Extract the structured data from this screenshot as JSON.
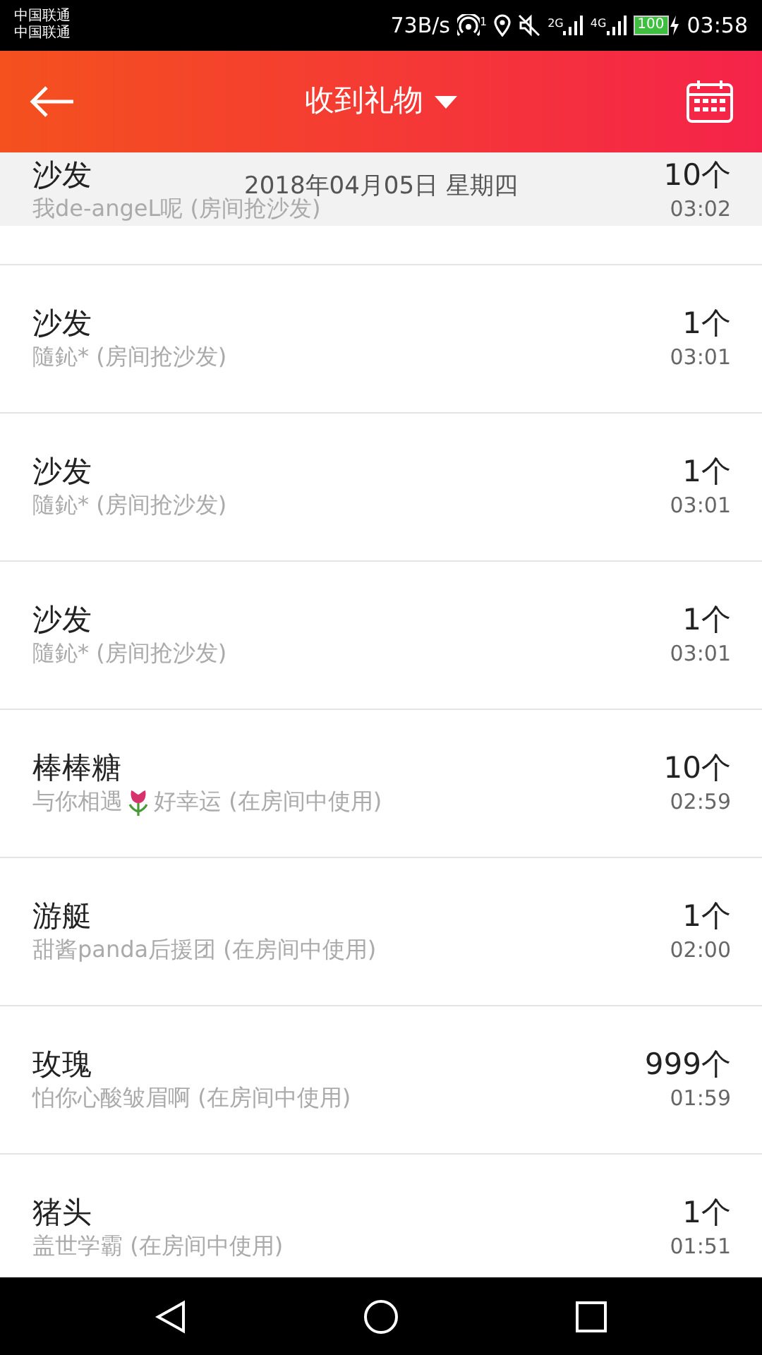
{
  "status_bar": {
    "carriers": [
      "中国联通",
      "中国联通"
    ],
    "speed": "73B/s",
    "hotspot_count": "1",
    "network_1": "2G",
    "network_2": "4G",
    "battery": "100",
    "time": "03:58"
  },
  "header": {
    "title": "收到礼物"
  },
  "date_header": "2018年04月05日 星期四",
  "gifts": [
    {
      "name": "沙发",
      "parts": [
        {
          "kind": "text",
          "text": "我de-angeL呢 (房间抢沙发)"
        }
      ],
      "count": "10个",
      "time": "03:02"
    },
    {
      "name": "沙发",
      "parts": [
        {
          "kind": "text",
          "text": "隨鈊* (房间抢沙发)"
        }
      ],
      "count": "1个",
      "time": "03:01"
    },
    {
      "name": "沙发",
      "parts": [
        {
          "kind": "text",
          "text": "隨鈊* (房间抢沙发)"
        }
      ],
      "count": "1个",
      "time": "03:01"
    },
    {
      "name": "沙发",
      "parts": [
        {
          "kind": "text",
          "text": "隨鈊* (房间抢沙发)"
        }
      ],
      "count": "1个",
      "time": "03:01"
    },
    {
      "name": "棒棒糖",
      "parts": [
        {
          "kind": "text",
          "text": "与你相遇"
        },
        {
          "kind": "tulip"
        },
        {
          "kind": "text",
          "text": "好幸运 (在房间中使用)"
        }
      ],
      "count": "10个",
      "time": "02:59"
    },
    {
      "name": "游艇",
      "parts": [
        {
          "kind": "text",
          "text": "甜酱panda后援团 (在房间中使用)"
        }
      ],
      "count": "1个",
      "time": "02:00"
    },
    {
      "name": "玫瑰",
      "parts": [
        {
          "kind": "text",
          "text": "怕你心酸皱眉啊 (在房间中使用)"
        }
      ],
      "count": "999个",
      "time": "01:59"
    },
    {
      "name": "猪头",
      "parts": [
        {
          "kind": "text",
          "text": "盖世学霸 (在房间中使用)"
        }
      ],
      "count": "1个",
      "time": "01:51"
    }
  ]
}
